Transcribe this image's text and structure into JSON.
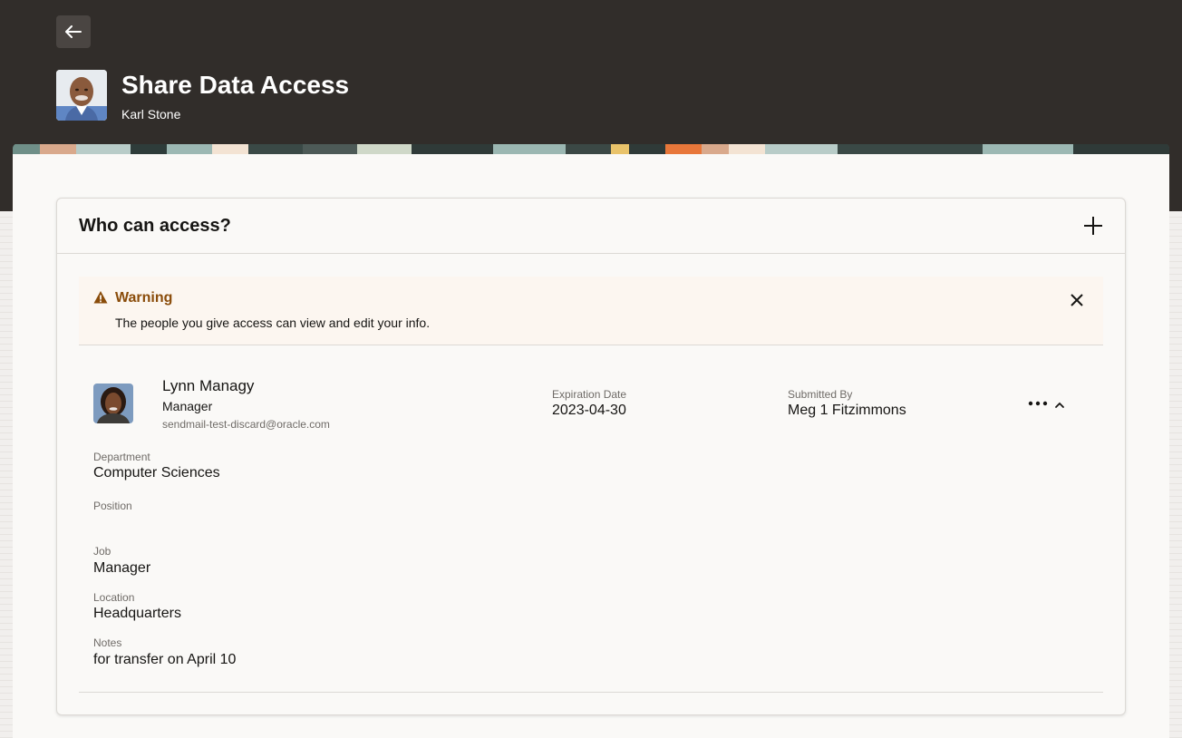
{
  "header": {
    "title": "Share Data Access",
    "subtitle": "Karl Stone",
    "back_icon": "arrow-left-icon"
  },
  "card": {
    "title": "Who can access?",
    "add_icon": "plus-icon"
  },
  "warning": {
    "title": "Warning",
    "message": "The people you give access can view and edit your info.",
    "icon": "warning-triangle-icon",
    "close_icon": "close-icon",
    "title_color": "#8a4c0a",
    "background": "#fcf6f0"
  },
  "access_entry": {
    "name": "Lynn Managy",
    "role": "Manager",
    "email": "sendmail-test-discard@oracle.com",
    "expiration_label": "Expiration Date",
    "expiration_value": "2023-04-30",
    "submitted_label": "Submitted By",
    "submitted_value": "Meg 1 Fitzimmons",
    "more_icon": "more-horizontal-icon",
    "collapse_icon": "chevron-up-icon",
    "details": {
      "department_label": "Department",
      "department_value": "Computer Sciences",
      "position_label": "Position",
      "position_value": "",
      "job_label": "Job",
      "job_value": "Manager",
      "location_label": "Location",
      "location_value": "Headquarters",
      "notes_label": "Notes",
      "notes_value": "for transfer on April 10"
    }
  },
  "colors": {
    "header_bg": "#312d2a",
    "panel_bg": "#faf9f7",
    "text_primary": "#161513",
    "text_secondary": "#6f6b67"
  }
}
